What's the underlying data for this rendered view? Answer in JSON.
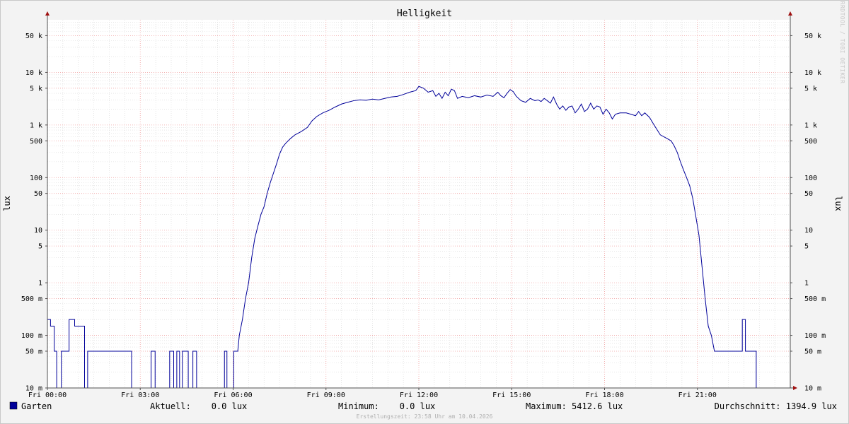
{
  "chart_data": {
    "type": "line",
    "title": "Helligkeit",
    "ylabel": "lux",
    "y_scale": "log",
    "ylim": [
      0.01,
      100000
    ],
    "y_ticks": [
      {
        "v": 0.01,
        "label": "10 m"
      },
      {
        "v": 0.05,
        "label": "50 m"
      },
      {
        "v": 0.1,
        "label": "100 m"
      },
      {
        "v": 0.5,
        "label": "500 m"
      },
      {
        "v": 1,
        "label": "1"
      },
      {
        "v": 5,
        "label": "5"
      },
      {
        "v": 10,
        "label": "10"
      },
      {
        "v": 50,
        "label": "50"
      },
      {
        "v": 100,
        "label": "100"
      },
      {
        "v": 500,
        "label": "500"
      },
      {
        "v": 1000,
        "label": "1 k"
      },
      {
        "v": 5000,
        "label": "5 k"
      },
      {
        "v": 10000,
        "label": "10 k"
      },
      {
        "v": 50000,
        "label": "50 k"
      }
    ],
    "x_ticks": [
      {
        "v": 0,
        "label": "Fri 00:00"
      },
      {
        "v": 3,
        "label": "Fri 03:00"
      },
      {
        "v": 6,
        "label": "Fri 06:00"
      },
      {
        "v": 9,
        "label": "Fri 09:00"
      },
      {
        "v": 12,
        "label": "Fri 12:00"
      },
      {
        "v": 15,
        "label": "Fri 15:00"
      },
      {
        "v": 18,
        "label": "Fri 18:00"
      },
      {
        "v": 21,
        "label": "Fri 21:00"
      }
    ],
    "xlim": [
      0,
      24
    ],
    "grid": true,
    "series": [
      {
        "name": "Garten",
        "color": "#000099",
        "points": [
          [
            0.0,
            0.2
          ],
          [
            0.1,
            0.2
          ],
          [
            0.1,
            0.15
          ],
          [
            0.22,
            0.15
          ],
          [
            0.22,
            0.05
          ],
          [
            0.3,
            0.05
          ],
          [
            0.3,
            0.01
          ],
          [
            0.45,
            0.01
          ],
          [
            0.45,
            0.05
          ],
          [
            0.7,
            0.05
          ],
          [
            0.7,
            0.2
          ],
          [
            0.88,
            0.2
          ],
          [
            0.88,
            0.15
          ],
          [
            1.2,
            0.15
          ],
          [
            1.2,
            0.01
          ],
          [
            1.3,
            0.01
          ],
          [
            1.3,
            0.05
          ],
          [
            2.72,
            0.05
          ],
          [
            2.72,
            0.01
          ],
          [
            3.35,
            0.01
          ],
          [
            3.35,
            0.05
          ],
          [
            3.48,
            0.05
          ],
          [
            3.48,
            0.01
          ],
          [
            3.95,
            0.01
          ],
          [
            3.95,
            0.05
          ],
          [
            4.08,
            0.05
          ],
          [
            4.08,
            0.01
          ],
          [
            4.18,
            0.01
          ],
          [
            4.18,
            0.05
          ],
          [
            4.27,
            0.05
          ],
          [
            4.27,
            0.01
          ],
          [
            4.36,
            0.01
          ],
          [
            4.36,
            0.05
          ],
          [
            4.55,
            0.05
          ],
          [
            4.55,
            0.01
          ],
          [
            4.7,
            0.01
          ],
          [
            4.7,
            0.05
          ],
          [
            4.82,
            0.05
          ],
          [
            4.82,
            0.01
          ],
          [
            5.72,
            0.01
          ],
          [
            5.72,
            0.05
          ],
          [
            5.8,
            0.05
          ],
          [
            5.8,
            0.01
          ],
          [
            6.02,
            0.01
          ],
          [
            6.02,
            0.05
          ],
          [
            6.15,
            0.05
          ],
          [
            6.2,
            0.1
          ],
          [
            6.3,
            0.2
          ],
          [
            6.4,
            0.5
          ],
          [
            6.5,
            1
          ],
          [
            6.6,
            3
          ],
          [
            6.7,
            7
          ],
          [
            6.8,
            12
          ],
          [
            6.9,
            20
          ],
          [
            7.0,
            28
          ],
          [
            7.1,
            50
          ],
          [
            7.2,
            80
          ],
          [
            7.3,
            120
          ],
          [
            7.4,
            180
          ],
          [
            7.5,
            280
          ],
          [
            7.6,
            380
          ],
          [
            7.7,
            450
          ],
          [
            7.85,
            550
          ],
          [
            8.0,
            650
          ],
          [
            8.2,
            750
          ],
          [
            8.4,
            900
          ],
          [
            8.55,
            1200
          ],
          [
            8.7,
            1450
          ],
          [
            8.9,
            1700
          ],
          [
            9.1,
            1900
          ],
          [
            9.3,
            2200
          ],
          [
            9.5,
            2500
          ],
          [
            9.7,
            2700
          ],
          [
            9.9,
            2900
          ],
          [
            10.1,
            3000
          ],
          [
            10.3,
            2950
          ],
          [
            10.5,
            3100
          ],
          [
            10.7,
            3000
          ],
          [
            10.9,
            3200
          ],
          [
            11.1,
            3400
          ],
          [
            11.3,
            3500
          ],
          [
            11.5,
            3800
          ],
          [
            11.7,
            4200
          ],
          [
            11.9,
            4500
          ],
          [
            12.0,
            5412.6
          ],
          [
            12.15,
            5000
          ],
          [
            12.3,
            4200
          ],
          [
            12.45,
            4500
          ],
          [
            12.55,
            3500
          ],
          [
            12.65,
            4000
          ],
          [
            12.75,
            3200
          ],
          [
            12.85,
            4200
          ],
          [
            12.95,
            3600
          ],
          [
            13.05,
            4800
          ],
          [
            13.15,
            4500
          ],
          [
            13.25,
            3200
          ],
          [
            13.4,
            3500
          ],
          [
            13.6,
            3300
          ],
          [
            13.8,
            3600
          ],
          [
            14.0,
            3400
          ],
          [
            14.2,
            3700
          ],
          [
            14.4,
            3500
          ],
          [
            14.55,
            4200
          ],
          [
            14.65,
            3600
          ],
          [
            14.75,
            3300
          ],
          [
            14.85,
            4000
          ],
          [
            14.95,
            4700
          ],
          [
            15.05,
            4300
          ],
          [
            15.15,
            3500
          ],
          [
            15.3,
            2900
          ],
          [
            15.45,
            2700
          ],
          [
            15.6,
            3200
          ],
          [
            15.75,
            2900
          ],
          [
            15.85,
            3000
          ],
          [
            15.95,
            2800
          ],
          [
            16.05,
            3200
          ],
          [
            16.15,
            2900
          ],
          [
            16.25,
            2600
          ],
          [
            16.35,
            3400
          ],
          [
            16.45,
            2500
          ],
          [
            16.55,
            2000
          ],
          [
            16.65,
            2300
          ],
          [
            16.75,
            1900
          ],
          [
            16.85,
            2200
          ],
          [
            16.95,
            2300
          ],
          [
            17.05,
            1700
          ],
          [
            17.15,
            2000
          ],
          [
            17.25,
            2500
          ],
          [
            17.35,
            1800
          ],
          [
            17.45,
            2000
          ],
          [
            17.55,
            2600
          ],
          [
            17.65,
            2000
          ],
          [
            17.75,
            2300
          ],
          [
            17.85,
            2200
          ],
          [
            17.95,
            1600
          ],
          [
            18.05,
            2000
          ],
          [
            18.15,
            1700
          ],
          [
            18.25,
            1300
          ],
          [
            18.35,
            1600
          ],
          [
            18.5,
            1700
          ],
          [
            18.7,
            1700
          ],
          [
            18.85,
            1600
          ],
          [
            19.0,
            1500
          ],
          [
            19.1,
            1800
          ],
          [
            19.2,
            1500
          ],
          [
            19.3,
            1700
          ],
          [
            19.45,
            1400
          ],
          [
            19.6,
            1000
          ],
          [
            19.8,
            650
          ],
          [
            20.0,
            560
          ],
          [
            20.15,
            500
          ],
          [
            20.25,
            400
          ],
          [
            20.35,
            300
          ],
          [
            20.45,
            200
          ],
          [
            20.55,
            140
          ],
          [
            20.65,
            100
          ],
          [
            20.75,
            70
          ],
          [
            20.85,
            40
          ],
          [
            20.95,
            18
          ],
          [
            21.05,
            8
          ],
          [
            21.15,
            2
          ],
          [
            21.25,
            0.5
          ],
          [
            21.35,
            0.15
          ],
          [
            21.45,
            0.1
          ],
          [
            21.55,
            0.05
          ],
          [
            22.45,
            0.05
          ],
          [
            22.45,
            0.2
          ],
          [
            22.55,
            0.2
          ],
          [
            22.55,
            0.05
          ],
          [
            22.9,
            0.05
          ],
          [
            22.9,
            0.01
          ],
          [
            24.0,
            0.01
          ]
        ]
      }
    ]
  },
  "legend": {
    "series_name": "Garten",
    "current": "Aktuell:    0.0 lux",
    "minimum": "Minimum:    0.0 lux",
    "maximum": "Maximum: 5412.6 lux",
    "average": "Durchschnitt: 1394.9 lux"
  },
  "footer": "Erstellungszeit: 23:58 Uhr am 10.04.2026",
  "watermark": "RRDTOOL / TOBI OETIKER",
  "colors": {
    "series": "#000099",
    "canvas": "#ffffff",
    "background": "#f3f3f3",
    "major_grid": "#f0a0a0",
    "minor_grid": "#d8d8d8",
    "axis": "#505050",
    "arrow": "#a01010"
  }
}
